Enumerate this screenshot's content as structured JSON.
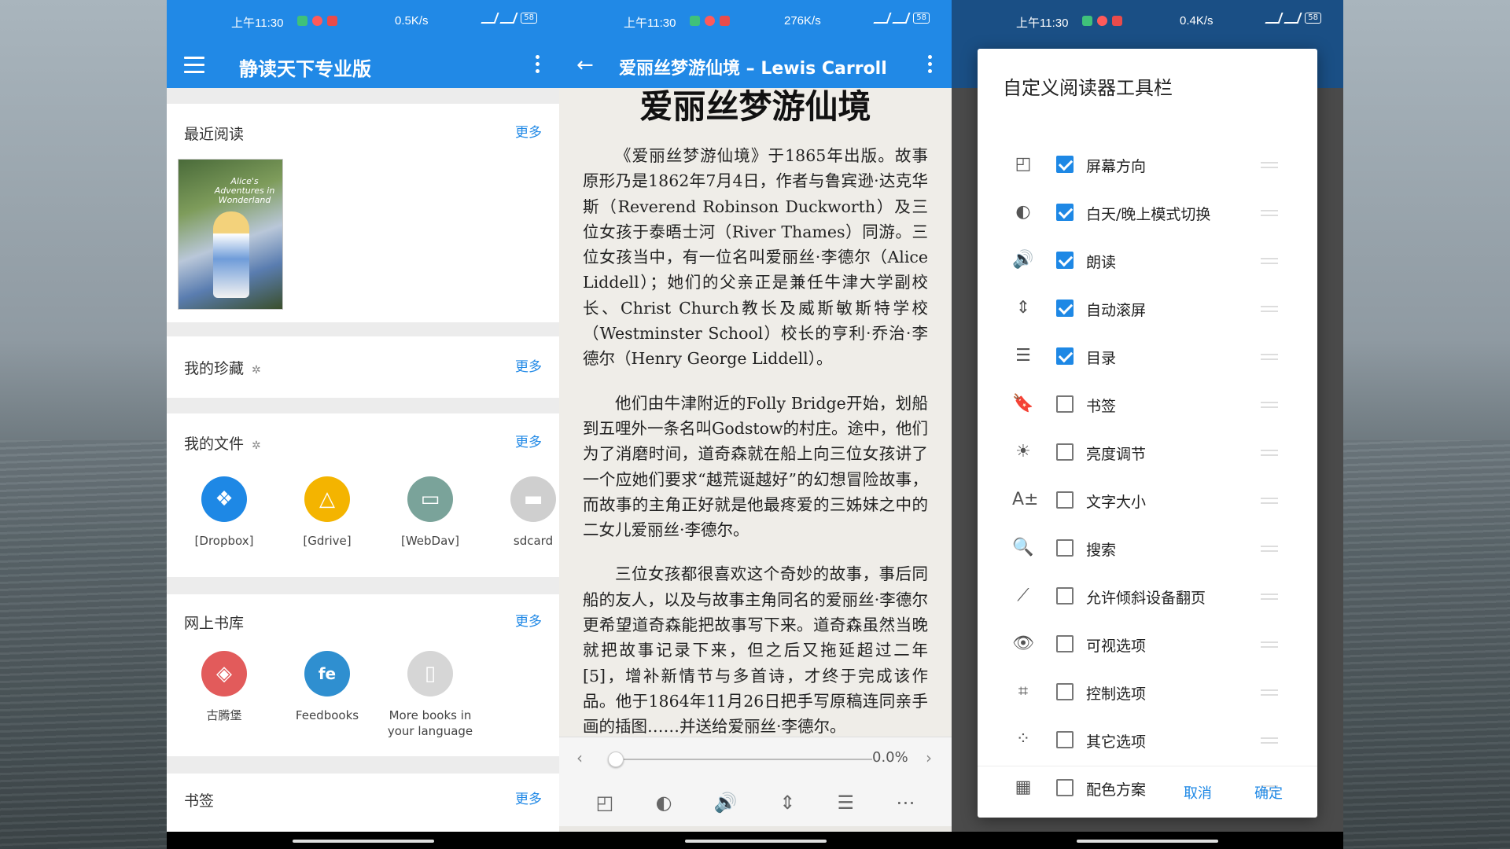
{
  "status": {
    "p1": {
      "time": "上午11:30",
      "rate": "0.5K/s",
      "battery": "58"
    },
    "p2": {
      "time": "上午11:30",
      "rate": "276K/s",
      "battery": "58"
    },
    "p3": {
      "time": "上午11:30",
      "rate": "0.4K/s",
      "battery": "58"
    }
  },
  "home": {
    "title": "静读天下专业版",
    "recent": {
      "title": "最近阅读",
      "more": "更多",
      "book_cover_text": "Alice's Adventures in Wonderland"
    },
    "favorites": {
      "title": "我的珍藏",
      "more": "更多"
    },
    "files": {
      "title": "我的文件",
      "more": "更多",
      "items": [
        {
          "label": "[Dropbox]",
          "icon": "dropbox-icon",
          "color": "#1e88e5"
        },
        {
          "label": "[Gdrive]",
          "icon": "gdrive-icon",
          "color": "#f4b400"
        },
        {
          "label": "[WebDav]",
          "icon": "webdav-icon",
          "color": "#7aa39a"
        },
        {
          "label": "sdcard",
          "icon": "folder-icon",
          "color": "#cfcfcf"
        }
      ]
    },
    "online": {
      "title": "网上书库",
      "more": "更多",
      "items": [
        {
          "label": "古腾堡",
          "icon": "gutenberg-icon",
          "color": "#e25b5b"
        },
        {
          "label": "Feedbooks",
          "icon": "feedbooks-icon",
          "color": "#2f8fd0"
        },
        {
          "label": "More books in your language",
          "icon": "open-book-icon",
          "color": "#d6d6d6"
        }
      ]
    },
    "bookmarks": {
      "title": "书签",
      "more": "更多"
    }
  },
  "reader": {
    "title": "爱丽丝梦游仙境 – Lewis Carroll",
    "chapter_title": "爱丽丝梦游仙境",
    "paragraphs": [
      "《爱丽丝梦游仙境》于1865年出版。故事原形乃是1862年7月4日，作者与鲁宾逊·达克华斯（Reverend Robinson Duckworth）及三位女孩于泰晤士河（River Thames）同游。三位女孩当中，有一位名叫爱丽丝·李德尔（Alice Liddell）；她们的父亲正是兼任牛津大学副校长、Christ Church教长及威斯敏斯特学校（Westminster School）校长的亨利·乔治·李德尔（Henry George Liddell）。",
      "他们由牛津附近的Folly Bridge开始，划船到五哩外一条名叫Godstow的村庄。途中，他们为了消磨时间，道奇森就在船上向三位女孩讲了一个应她们要求“越荒诞越好”的幻想冒险故事，而故事的主角正好就是他最疼爱的三姊妹之中的二女儿爱丽丝·李德尔。",
      "三位女孩都很喜欢这个奇妙的故事，事后同船的友人，以及与故事主角同名的爱丽丝·李德尔更希望道奇森能把故事写下来。道奇森虽然当晚就把故事记录下来，但之后又拖延超过二年[5]，增补新情节与多首诗，才终于完成该作品。他于1864年11月26日把手写原稿连同亲手画的插图……并送给爱丽丝·李德尔。"
    ],
    "progress_label": "0.0%",
    "progress": 0.0,
    "toolbar_icons": [
      "screen-orientation-icon",
      "day-night-icon",
      "speaker-icon",
      "auto-scroll-icon",
      "toc-icon",
      "more-icon"
    ]
  },
  "dialog": {
    "title": "自定义阅读器工具栏",
    "options": [
      {
        "label": "屏幕方向",
        "checked": true,
        "icon": "screen-orientation-icon",
        "glyph": "◰"
      },
      {
        "label": "白天/晚上模式切换",
        "checked": true,
        "icon": "day-night-icon",
        "glyph": "◐"
      },
      {
        "label": "朗读",
        "checked": true,
        "icon": "speaker-icon",
        "glyph": "🔊"
      },
      {
        "label": "自动滚屏",
        "checked": true,
        "icon": "auto-scroll-icon",
        "glyph": "⇕"
      },
      {
        "label": "目录",
        "checked": true,
        "icon": "toc-icon",
        "glyph": "☰"
      },
      {
        "label": "书签",
        "checked": false,
        "icon": "bookmark-icon",
        "glyph": "🔖"
      },
      {
        "label": "亮度调节",
        "checked": false,
        "icon": "brightness-icon",
        "glyph": "☀"
      },
      {
        "label": "文字大小",
        "checked": false,
        "icon": "font-size-icon",
        "glyph": "A±"
      },
      {
        "label": "搜索",
        "checked": false,
        "icon": "search-icon",
        "glyph": "🔍"
      },
      {
        "label": "允许倾斜设备翻页",
        "checked": false,
        "icon": "tilt-icon",
        "glyph": "⟋"
      },
      {
        "label": "可视选项",
        "checked": false,
        "icon": "eye-icon",
        "glyph": "👁"
      },
      {
        "label": "控制选项",
        "checked": false,
        "icon": "controls-icon",
        "glyph": "⌗"
      },
      {
        "label": "其它选项",
        "checked": false,
        "icon": "other-options-icon",
        "glyph": "⁘"
      },
      {
        "label": "配色方案",
        "checked": false,
        "icon": "color-scheme-icon",
        "glyph": "▦"
      }
    ],
    "cancel": "取消",
    "ok": "确定"
  }
}
